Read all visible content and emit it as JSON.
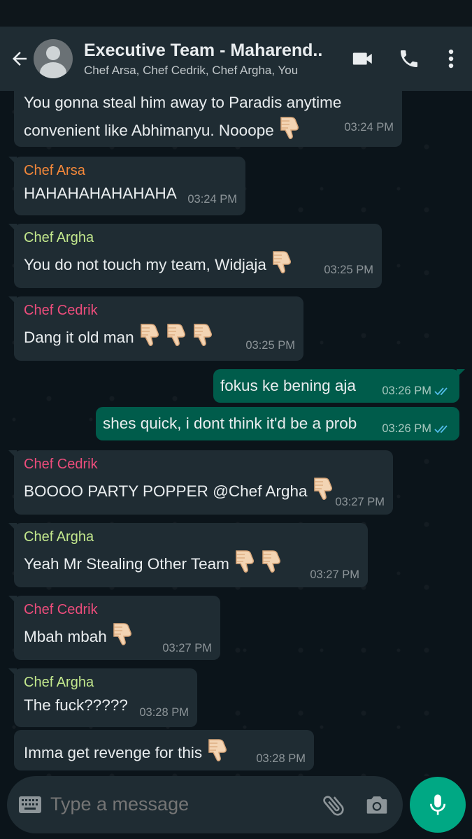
{
  "header": {
    "title": "Executive Team - Maharend...",
    "subtitle": "Chef Arsa, Chef Cedrik, Chef Argha, You"
  },
  "colors": {
    "arsa": "#f4883a",
    "argha": "#c3e88d",
    "cedrik": "#ee4d7c",
    "accent": "#00a884"
  },
  "messages": [
    {
      "direction": "in",
      "sender": "",
      "lines": [
        "You gonna steal him away to Paradis anytime",
        "convenient like Abhimanyu. Nooope"
      ],
      "emoji_count": 1,
      "time": "03:24 PM"
    },
    {
      "direction": "in",
      "sender": "Chef Arsa",
      "text": "HAHAHAHAHAHAHA",
      "emoji_count": 0,
      "time": "03:24 PM"
    },
    {
      "direction": "in",
      "sender": "Chef Argha",
      "text": "You do not touch my team, Widjaja",
      "emoji_count": 1,
      "time": "03:25 PM"
    },
    {
      "direction": "in",
      "sender": "Chef Cedrik",
      "text": "Dang it old man",
      "emoji_count": 3,
      "time": "03:25 PM"
    },
    {
      "direction": "out",
      "text": "fokus ke bening aja",
      "time": "03:26 PM",
      "status": "read"
    },
    {
      "direction": "out",
      "text": "shes quick, i dont think it'd be a prob",
      "time": "03:26 PM",
      "status": "read"
    },
    {
      "direction": "in",
      "sender": "Chef Cedrik",
      "text": "BOOOO PARTY POPPER @Chef Argha",
      "emoji_count": 1,
      "time": "03:27 PM"
    },
    {
      "direction": "in",
      "sender": "Chef Argha",
      "text": "Yeah Mr Stealing Other Team",
      "emoji_count": 2,
      "time": "03:27 PM"
    },
    {
      "direction": "in",
      "sender": "Chef Cedrik",
      "text": "Mbah mbah",
      "emoji_count": 1,
      "time": "03:27 PM"
    },
    {
      "direction": "in",
      "sender": "Chef Argha",
      "text": "The fuck?????",
      "emoji_count": 0,
      "time": "03:28 PM"
    },
    {
      "direction": "in",
      "sender": "",
      "text": "Imma get revenge for this",
      "emoji_count": 1,
      "time": "03:28 PM"
    }
  ],
  "composer": {
    "placeholder": "Type a message"
  }
}
